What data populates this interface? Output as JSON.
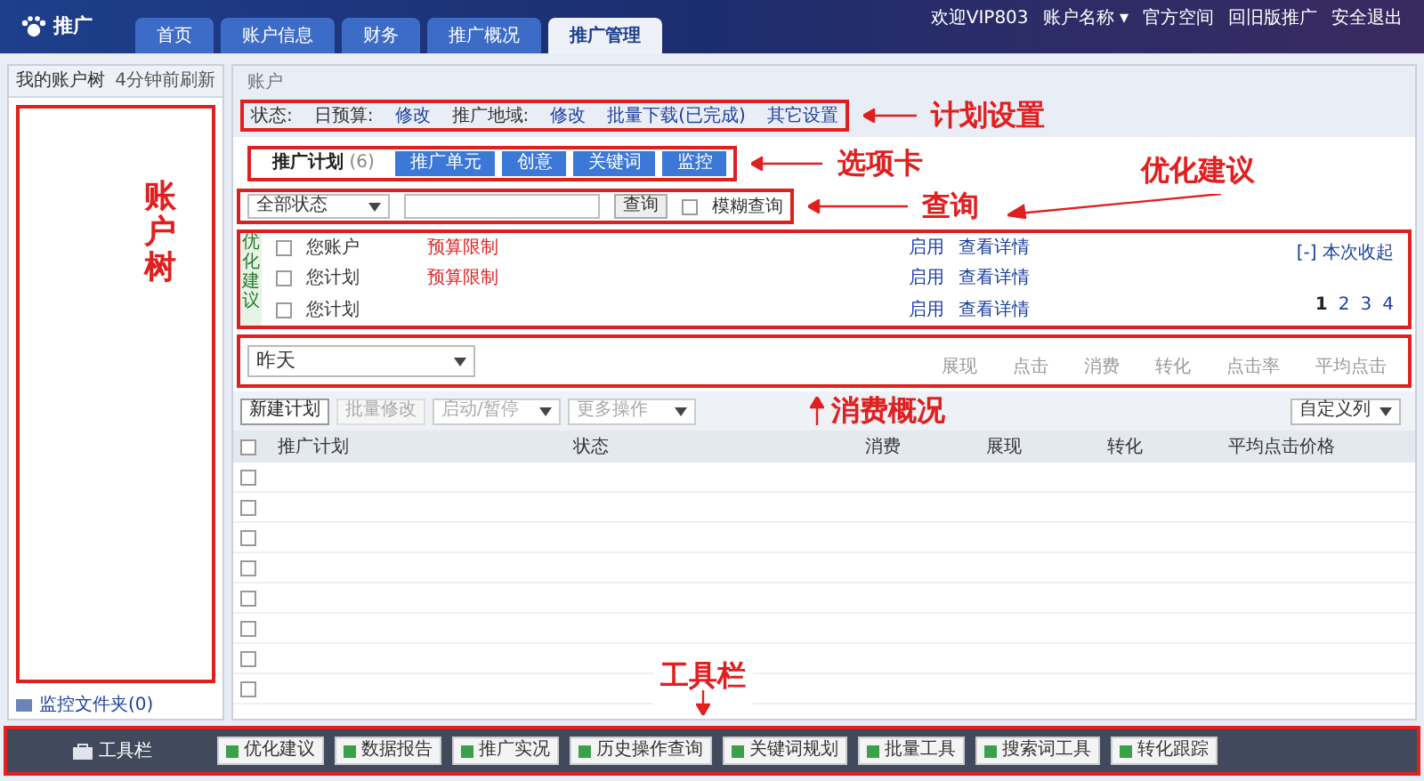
{
  "header": {
    "logo": "推广",
    "tabs": [
      {
        "label": "首页",
        "selected": false
      },
      {
        "label": "账户信息",
        "selected": false
      },
      {
        "label": "财务",
        "selected": false
      },
      {
        "label": "推广概况",
        "selected": false
      },
      {
        "label": "推广管理",
        "selected": true
      }
    ],
    "links": [
      "欢迎VIP803",
      "账户名称 ▾",
      "官方空间",
      "回旧版推广",
      "安全退出"
    ]
  },
  "sidebar": {
    "title": "我的账户树",
    "refresh": "4分钟前刷新",
    "footer": "监控文件夹(0)"
  },
  "breadcrumb": "账户",
  "plan_settings": [
    {
      "kind": "label",
      "text": "状态:"
    },
    {
      "kind": "label",
      "text": "日预算:"
    },
    {
      "kind": "link",
      "text": "修改"
    },
    {
      "kind": "label",
      "text": "推广地域:"
    },
    {
      "kind": "link",
      "text": "修改"
    },
    {
      "kind": "link",
      "text": "批量下载(已完成)"
    },
    {
      "kind": "link",
      "text": "其它设置"
    }
  ],
  "tabs": [
    {
      "label": "推广计划",
      "count": "(6)",
      "selected": true
    },
    {
      "label": "推广单元",
      "selected": false
    },
    {
      "label": "创意",
      "selected": false
    },
    {
      "label": "关键词",
      "selected": false
    },
    {
      "label": "监控",
      "selected": false
    }
  ],
  "query": {
    "status": "全部状态",
    "button": "查询",
    "fuzzy_label": "模糊查询",
    "fuzzy_checked": false
  },
  "suggestions": {
    "side_label": "优化建议",
    "toggle": "[-] 本次收起",
    "rows": [
      {
        "text": "您账户",
        "tag": "预算限制",
        "checked": false,
        "actions": [
          "启用",
          "查看详情"
        ]
      },
      {
        "text": "您计划",
        "tag": "预算限制",
        "checked": false,
        "actions": [
          "启用",
          "查看详情"
        ]
      },
      {
        "text": "您计划",
        "checked": false,
        "actions": [
          "启用",
          "查看详情"
        ]
      }
    ],
    "pages": [
      {
        "label": "1",
        "selected": true
      },
      {
        "label": "2",
        "selected": false
      },
      {
        "label": "3",
        "selected": false
      },
      {
        "label": "4",
        "selected": false
      }
    ]
  },
  "spend": {
    "period": "昨天",
    "metrics": [
      "展现",
      "点击",
      "消费",
      "转化",
      "点击率",
      "平均点击"
    ]
  },
  "toolbar": {
    "buttons": [
      {
        "label": "新建计划",
        "disabled": false
      },
      {
        "label": "批量修改",
        "disabled": true
      }
    ],
    "selects": [
      "启动/暂停",
      "更多操作"
    ],
    "custom_columns": "自定义列"
  },
  "table": {
    "header_checked": false,
    "columns": [
      "推广计划",
      "状态",
      "消费",
      "展现",
      "转化",
      "平均点击价格"
    ],
    "rows": [
      {
        "checked": false
      },
      {
        "checked": false
      },
      {
        "checked": false
      },
      {
        "checked": false
      },
      {
        "checked": false
      },
      {
        "checked": false
      },
      {
        "checked": false
      },
      {
        "checked": false
      }
    ]
  },
  "bottom_toolbar": {
    "title": "工具栏",
    "tools": [
      "优化建议",
      "数据报告",
      "推广实况",
      "历史操作查询",
      "关键词规划",
      "批量工具",
      "搜索词工具",
      "转化跟踪"
    ]
  },
  "annotations": {
    "plan_settings": "计划设置",
    "tabs": "选项卡",
    "query": "查询",
    "suggestions": "优化建议",
    "account_tree": "账户树",
    "spend": "消费概况",
    "toolbar": "工具栏"
  }
}
